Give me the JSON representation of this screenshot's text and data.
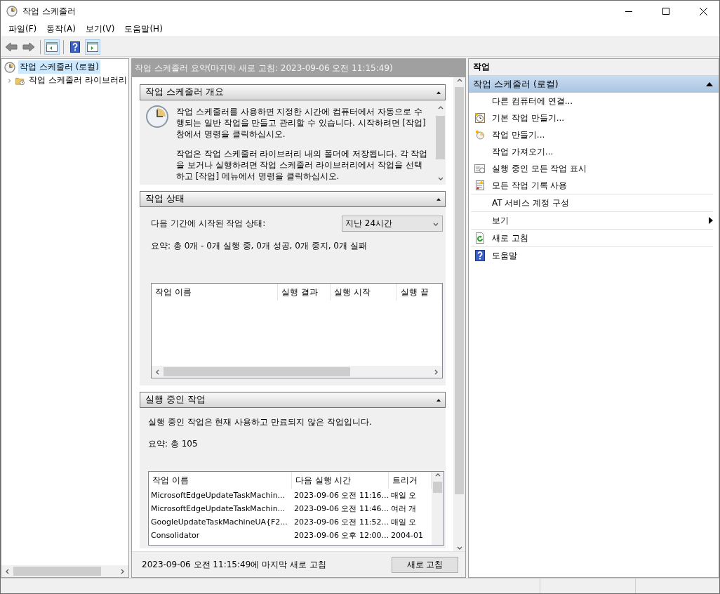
{
  "window": {
    "title": "작업 스케줄러"
  },
  "menu": [
    {
      "label": "파일(F)"
    },
    {
      "label": "동작(A)"
    },
    {
      "label": "보기(V)"
    },
    {
      "label": "도움말(H)"
    }
  ],
  "tree": [
    {
      "label": "작업 스케줄러 (로컬)",
      "selected": true,
      "children": [
        {
          "label": "작업 스케줄러 라이브러리",
          "selected": false,
          "expanded": false
        }
      ]
    }
  ],
  "summary": {
    "header": "작업 스케줄러 요약(마지막 새로 고침: 2023-09-06 오전 11:15:49)",
    "sections": [
      {
        "kind": "overview",
        "title": "작업 스케줄러 개요",
        "expanded": true,
        "paragraphs": [
          "작업 스케줄러를 사용하면 지정한 시간에 컴퓨터에서 자동으로 수행되는 일반 작업을 만들고 관리할 수 있습니다. 시작하려면 [작업] 창에서 명령을 클릭하십시오.",
          "작업은 작업 스케줄러 라이브러리 내의 폴더에 저장됩니다. 각 작업을 보거나 실행하려면 작업 스케줄러 라이브러리에서 작업을 선택하고 [작업] 메뉴에서 명령을 클릭하십시오."
        ]
      },
      {
        "kind": "status",
        "title": "작업 상태",
        "expanded": true,
        "period_label": "다음 기간에 시작된 작업 상태:",
        "period": "지난 24시간",
        "summary": "요약: 총 0개 - 0개 실행 중, 0개 성공, 0개 중지, 0개 실패",
        "columns": [
          "작업 이름",
          "실행 결과",
          "실행 시작",
          "실행 끝"
        ]
      },
      {
        "kind": "running",
        "title": "실행 중인 작업",
        "expanded": true,
        "description": "실행 중인 작업은 현재 사용하고 만료되지 않은 작업입니다.",
        "summary": "요약: 총 105",
        "columns": [
          "작업 이름",
          "다음 실행 시간",
          "트리거"
        ],
        "rows": [
          [
            "MicrosoftEdgeUpdateTaskMachin...",
            "2023-09-06 오전 11:16...",
            "매일 오"
          ],
          [
            "MicrosoftEdgeUpdateTaskMachin...",
            "2023-09-06 오전 11:46...",
            "여러 개"
          ],
          [
            "GoogleUpdateTaskMachineUA{F2...",
            "2023-09-06 오전 11:52...",
            "매일 오"
          ],
          [
            "Consolidator",
            "2023-09-06 오후 12:00...",
            "2004-01"
          ]
        ]
      }
    ],
    "footer": {
      "text": "2023-09-06 오전 11:15:49에 마지막 새로 고침",
      "button": "새로 고침"
    }
  },
  "actions": {
    "title": "작업",
    "group": {
      "label": "작업 스케줄러 (로컬)",
      "expanded": true
    },
    "groups": [
      [
        {
          "kind": "plain",
          "label": "다른 컴퓨터에 연결..."
        },
        {
          "kind": "basic_task",
          "label": "기본 작업 만들기..."
        },
        {
          "kind": "create_task",
          "label": "작업 만들기..."
        },
        {
          "kind": "plain",
          "label": "작업 가져오기..."
        },
        {
          "kind": "running",
          "label": "실행 중인 모든 작업 표시"
        },
        {
          "kind": "history",
          "label": "모든 작업 기록 사용"
        }
      ],
      [
        {
          "kind": "plain",
          "label": "AT 서비스 계정 구성"
        }
      ],
      [
        {
          "kind": "submenu",
          "label": "보기"
        }
      ],
      [
        {
          "kind": "refresh",
          "label": "새로 고침"
        }
      ],
      [
        {
          "kind": "help",
          "label": "도움말"
        }
      ]
    ]
  }
}
